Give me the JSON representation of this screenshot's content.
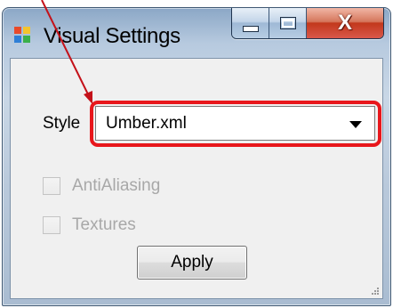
{
  "window": {
    "title": "Visual Settings",
    "close_glyph": "X"
  },
  "form": {
    "style_label": "Style",
    "style_select": {
      "value": "Umber.xml"
    },
    "antialiasing": {
      "label": "AntiAliasing",
      "checked": false,
      "enabled": false
    },
    "textures": {
      "label": "Textures",
      "checked": false,
      "enabled": false
    },
    "apply_label": "Apply"
  },
  "colors": {
    "highlight": "#e8171c",
    "disabled_text": "#a8a8a8",
    "client_background": "#f0f0f0"
  }
}
